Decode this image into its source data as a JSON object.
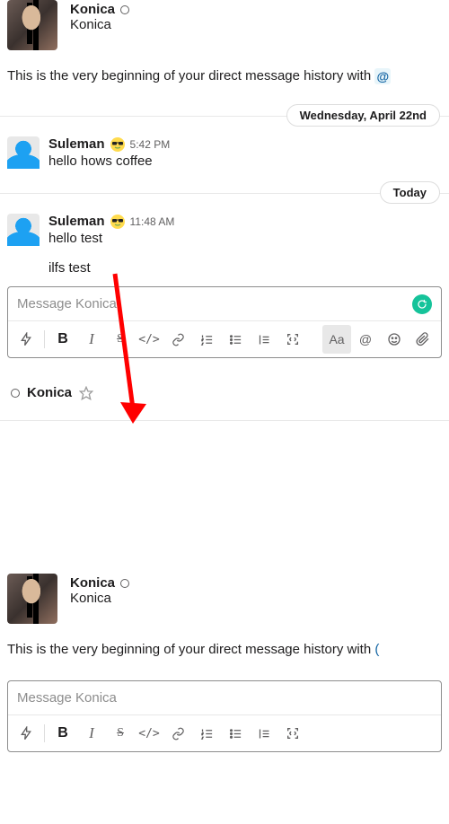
{
  "top": {
    "name": "Konica",
    "sub": "Konica",
    "intro": "This is the very beginning of your direct message history with ",
    "mention_glyph": "@"
  },
  "dividers": {
    "d1": "Wednesday, April 22nd",
    "d2": "Today"
  },
  "messages": {
    "m1": {
      "name": "Suleman",
      "time": "5:42 PM",
      "line1": "hello hows coffee"
    },
    "m2": {
      "name": "Suleman",
      "time": "11:48 AM",
      "line1": "hello test",
      "line2": "ilfs test"
    }
  },
  "composer": {
    "placeholder": "Message Konica",
    "aa": "Aa",
    "bold": "B",
    "italic": "I",
    "strike": "S",
    "code": "</>",
    "at": "@"
  },
  "section": {
    "name": "Konica"
  },
  "bottom": {
    "name": "Konica",
    "sub": "Konica",
    "intro": "This is the very beginning of your direct message history with "
  }
}
